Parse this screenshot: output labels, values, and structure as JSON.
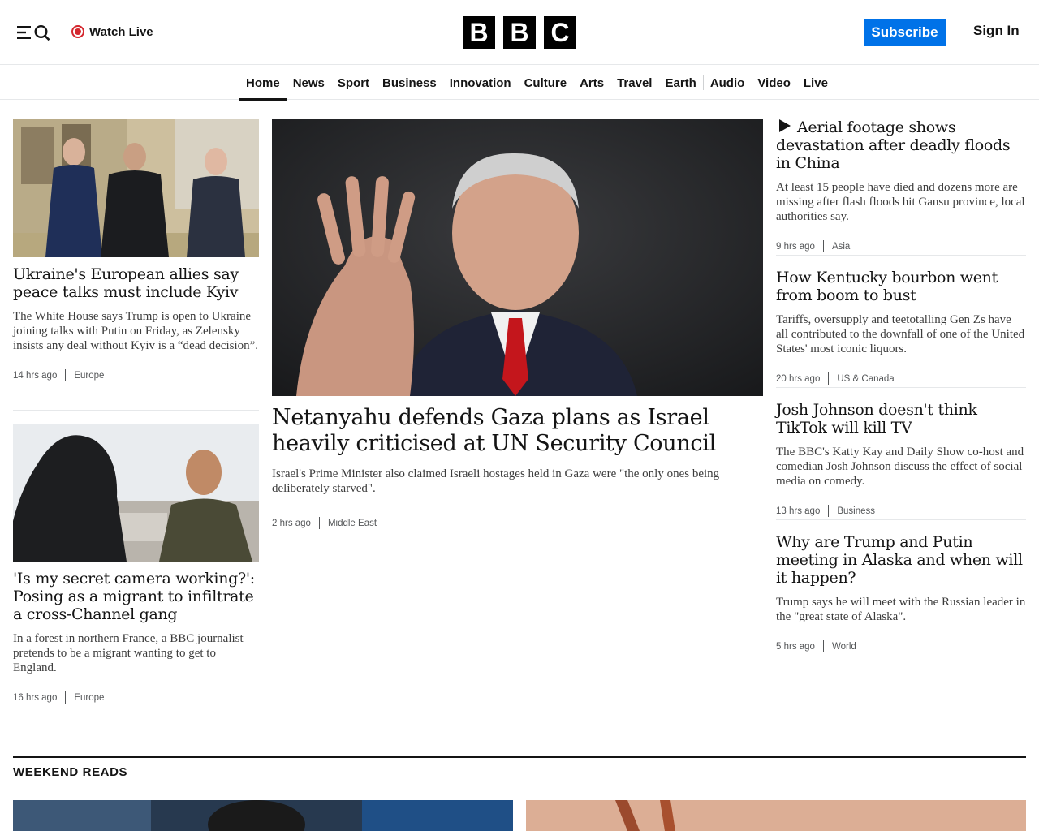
{
  "header": {
    "watch_live": "Watch Live",
    "logo_letters": [
      "B",
      "B",
      "C"
    ],
    "subscribe": "Subscribe",
    "sign_in": "Sign In"
  },
  "nav": [
    "Home",
    "News",
    "Sport",
    "Business",
    "Innovation",
    "Culture",
    "Arts",
    "Travel",
    "Earth",
    "Audio",
    "Video",
    "Live"
  ],
  "nav_active": "Home",
  "left_stories": [
    {
      "headline": "Ukraine's European allies say peace talks must include Kyiv",
      "summary": "The White House says Trump is open to Ukraine joining talks with Putin on Friday, as Zelensky insists any deal without Kyiv is a “dead decision”.",
      "time": "14 hrs ago",
      "section": "Europe"
    },
    {
      "headline": "'Is my secret camera working?': Posing as a migrant to infiltrate a cross-Channel gang",
      "summary": "In a forest in northern France, a BBC journalist pretends to be a migrant wanting to get to England.",
      "time": "16 hrs ago",
      "section": "Europe"
    }
  ],
  "main_story": {
    "headline": "Netanyahu defends Gaza plans as Israel heavily criticised at UN Security Council",
    "summary": "Israel's Prime Minister also claimed Israeli hostages held in Gaza were \"the only ones being deliberately starved\".",
    "time": "2 hrs ago",
    "section": "Middle East"
  },
  "right_stories": [
    {
      "headline": "Aerial footage shows devastation after deadly floods in China",
      "summary": "At least 15 people have died and dozens more are missing after flash floods hit Gansu province, local authorities say.",
      "time": "9 hrs ago",
      "section": "Asia",
      "video": true
    },
    {
      "headline": "How Kentucky bourbon went from boom to bust",
      "summary": "Tariffs, oversupply and teetotalling Gen Zs have all contributed to the downfall of one of the United States' most iconic liquors.",
      "time": "20 hrs ago",
      "section": "US & Canada"
    },
    {
      "headline": "Josh Johnson doesn't think TikTok will kill TV",
      "summary": "The BBC's Katty Kay and Daily Show co-host and comedian Josh Johnson discuss the effect of social media on comedy.",
      "time": "13 hrs ago",
      "section": "Business"
    },
    {
      "headline": "Why are Trump and Putin meeting in Alaska and when will it happen?",
      "summary": "Trump says he will meet with the Russian leader in the \"great state of Alaska\".",
      "time": "5 hrs ago",
      "section": "World"
    }
  ],
  "weekend_reads": {
    "title": "WEEKEND READS"
  },
  "colors": {
    "subscribe_bg": "#0072e8",
    "live_red": "#d4272e",
    "text": "#141414"
  }
}
